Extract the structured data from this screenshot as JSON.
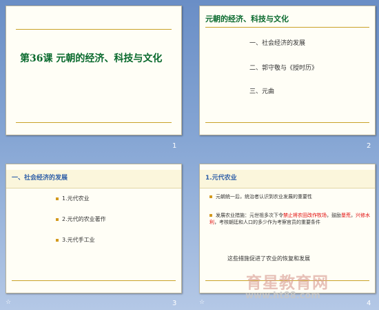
{
  "slides": [
    {
      "number": "1",
      "title": "第36课 元朝的经济、科技与文化"
    },
    {
      "number": "2",
      "title": "元朝的经济、科技与文化",
      "items": [
        "一、社会经济的发展",
        "二、郭守敬与《授时历》",
        "三、元曲"
      ]
    },
    {
      "number": "3",
      "title": "一、社会经济的发展",
      "items": [
        "1.元代农业",
        "2.元代的农业著作",
        "3.元代手工业"
      ]
    },
    {
      "number": "4",
      "title": "1.元代农业",
      "para1": "元朝统一后，统治者认识到农业发展的重要性",
      "para2_a": "发展农业措施：元世祖多次下令",
      "para2_red1": "禁止将农田改作牧场",
      "para2_b": "，鼓励",
      "para2_red2": "垦荒",
      "para2_c": "，",
      "para2_red3": "兴修水利",
      "para2_d": "，考核朝廷和人口的多少作为考察官员的重要条件",
      "bottom": "这些措施促进了农业的恢复和发展"
    }
  ],
  "transition_icon": "☆",
  "watermark": {
    "text": "育星教育网",
    "url": "www.ht88.com"
  }
}
